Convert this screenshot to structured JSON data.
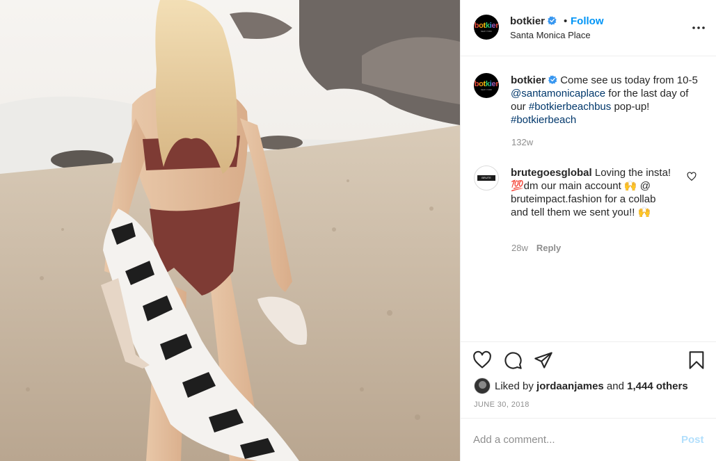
{
  "post": {
    "author": "botkier",
    "avatar_logo": "botkier",
    "avatar_sub": "NEW YORK",
    "follow_label": "Follow",
    "separator": "•",
    "location": "Santa Monica Place",
    "caption": {
      "text_before": "Come see us today from 10-5 ",
      "mention": "@santamonicaplace",
      "text_middle": " for the last day of our ",
      "hashtag1": "#botkierbeachbus",
      "text_after": " pop-up! ",
      "hashtag2": "#botkierbeach",
      "time": "132w"
    },
    "comment": {
      "author": "brutegoesglobal",
      "avatar_text": "BRUTE IMPACT",
      "text": " Loving the insta! 💯dm our main account 🙌 @ bruteimpact.fashion for a collab and tell them we sent you!! 🙌",
      "time": "28w",
      "reply_label": "Reply"
    },
    "likes": {
      "prefix": "Liked by ",
      "user": "jordaanjames",
      "middle": " and ",
      "others": "1,444 others"
    },
    "date": "JUNE 30, 2018",
    "add_comment_placeholder": "Add a comment...",
    "post_label": "Post"
  },
  "colors": {
    "accent": "#0095f6",
    "link": "#00376b",
    "muted": "#8e8e8e",
    "post_disabled": "#b2dffc",
    "verified": "#3897f0"
  },
  "icons": {
    "like": "heart-icon",
    "comment": "comment-bubble-icon",
    "share": "paper-plane-icon",
    "save": "bookmark-icon",
    "more": "more-dots-icon"
  }
}
